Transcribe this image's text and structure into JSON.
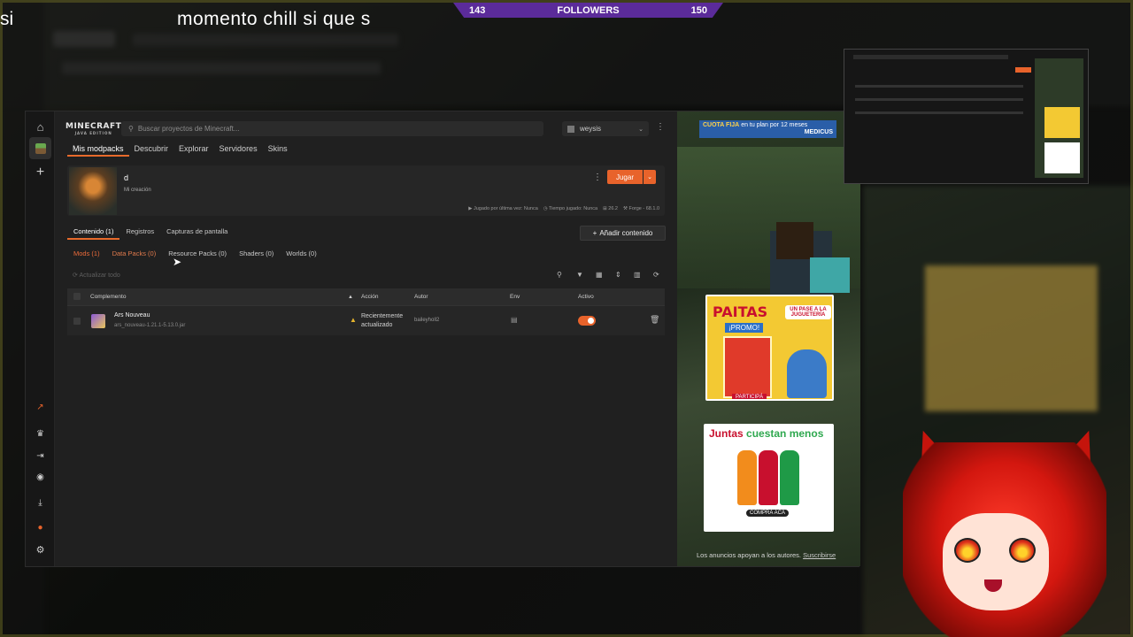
{
  "overlay": {
    "left_text": "si",
    "caption": "momento  chill  si  que  s",
    "followers": {
      "current": "143",
      "label": "FOLLOWERS",
      "goal": "150"
    }
  },
  "app": {
    "logo": "MINECRAFT",
    "logo_sub": "JAVA EDITION",
    "search_placeholder": "Buscar proyectos de Minecraft...",
    "profile_name": "weysis",
    "nav_tabs": [
      "Mis modpacks",
      "Descubrir",
      "Explorar",
      "Servidores",
      "Skins"
    ],
    "pack": {
      "name": "d",
      "subtitle": "Mi creación",
      "play_label": "Jugar",
      "meta": [
        "Jugado por última vez: Nunca",
        "Tiempo jugado: Nunca",
        "26.2",
        "Forge - 68.1.0"
      ]
    },
    "content_tabs": [
      "Contenido (1)",
      "Registros",
      "Capturas de pantalla"
    ],
    "add_content": "Añadir contenido",
    "filters": [
      "Mods (1)",
      "Data Packs (0)",
      "Resource Packs (0)",
      "Shaders (0)",
      "Worlds (0)"
    ],
    "update_all": "Actualizar todo",
    "table": {
      "headers": {
        "addon": "Complemento",
        "action": "Acción",
        "author": "Autor",
        "env": "Env",
        "active": "Activo"
      },
      "rows": [
        {
          "name": "Ars Nouveau",
          "file": "ars_nouveau-1.21.1-5.13.0.jar",
          "action": "Recientemente actualizado",
          "author": "baileyholl2"
        }
      ]
    }
  },
  "ads": {
    "banner": {
      "headline": "CUOTA FIJA",
      "text": "en tu plan por 12 meses",
      "brand": "MEDICUS"
    },
    "ad1": {
      "brand": "PAITAS",
      "tag": "¡PROMO!",
      "offer": "UN PASE A LA JUGUETERÍA",
      "cta": "PARTICIPÁ"
    },
    "ad2": {
      "headline_a": "Juntas ",
      "headline_b": "cuestan menos",
      "cta": "COMPRÁ ACÁ"
    },
    "footer": "Los anuncios apoyan a los autores.",
    "subscribe": "Suscribirse"
  },
  "colors": {
    "accent": "#e8632b",
    "followers_bar": "#5b2b9a"
  }
}
